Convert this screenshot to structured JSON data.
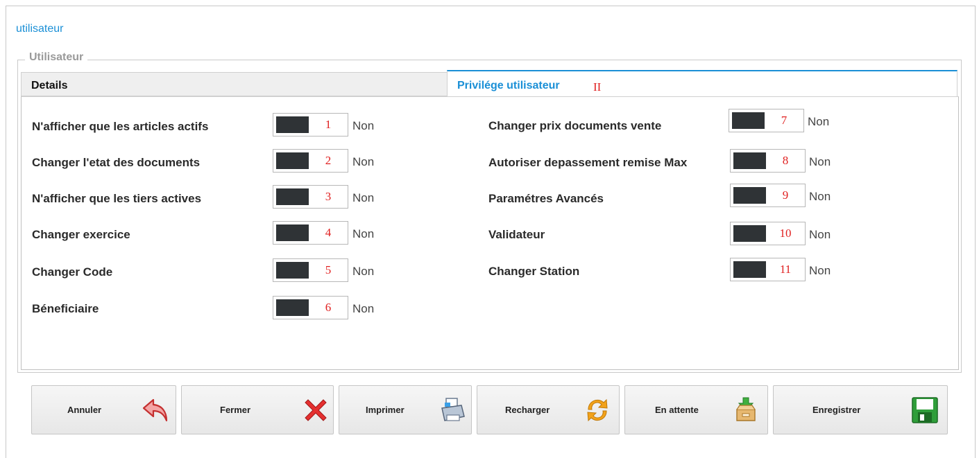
{
  "page_title": "utilisateur",
  "fieldset_legend": "Utilisateur",
  "tabs": [
    {
      "label": "Details",
      "active": false
    },
    {
      "label": "Privilége utilisateur",
      "active": true,
      "marker": "II"
    }
  ],
  "left_rows": [
    {
      "label": "N'afficher que les articles actifs",
      "num": "1",
      "value": "Non"
    },
    {
      "label": "Changer l'etat des documents",
      "num": "2",
      "value": "Non"
    },
    {
      "label": "N'afficher que les tiers actives",
      "num": "3",
      "value": "Non"
    },
    {
      "label": "Changer exercice",
      "num": "4",
      "value": "Non"
    },
    {
      "label": "Changer Code",
      "num": "5",
      "value": "Non"
    },
    {
      "label": "Béneficiaire",
      "num": "6",
      "value": "Non"
    }
  ],
  "right_rows": [
    {
      "label": "Changer prix documents vente",
      "num": "7",
      "value": "Non"
    },
    {
      "label": "Autoriser depassement remise Max",
      "num": "8",
      "value": "Non"
    },
    {
      "label": "Paramétres Avancés",
      "num": "9",
      "value": "Non"
    },
    {
      "label": "Validateur",
      "num": "10",
      "value": "Non"
    },
    {
      "label": "Changer Station",
      "num": "11",
      "value": "Non"
    }
  ],
  "buttons": [
    {
      "label": "Annuler",
      "icon": "undo-arrow-icon"
    },
    {
      "label": "Fermer",
      "icon": "close-x-icon"
    },
    {
      "label": "Imprimer",
      "icon": "printer-icon"
    },
    {
      "label": "Recharger",
      "icon": "refresh-icon"
    },
    {
      "label": "En attente",
      "icon": "inbox-download-icon"
    },
    {
      "label": "Enregistrer",
      "icon": "floppy-save-icon"
    }
  ],
  "colors": {
    "accent": "#1a8fd6",
    "marker": "#e02020",
    "toggle_knob": "#2f3336"
  }
}
